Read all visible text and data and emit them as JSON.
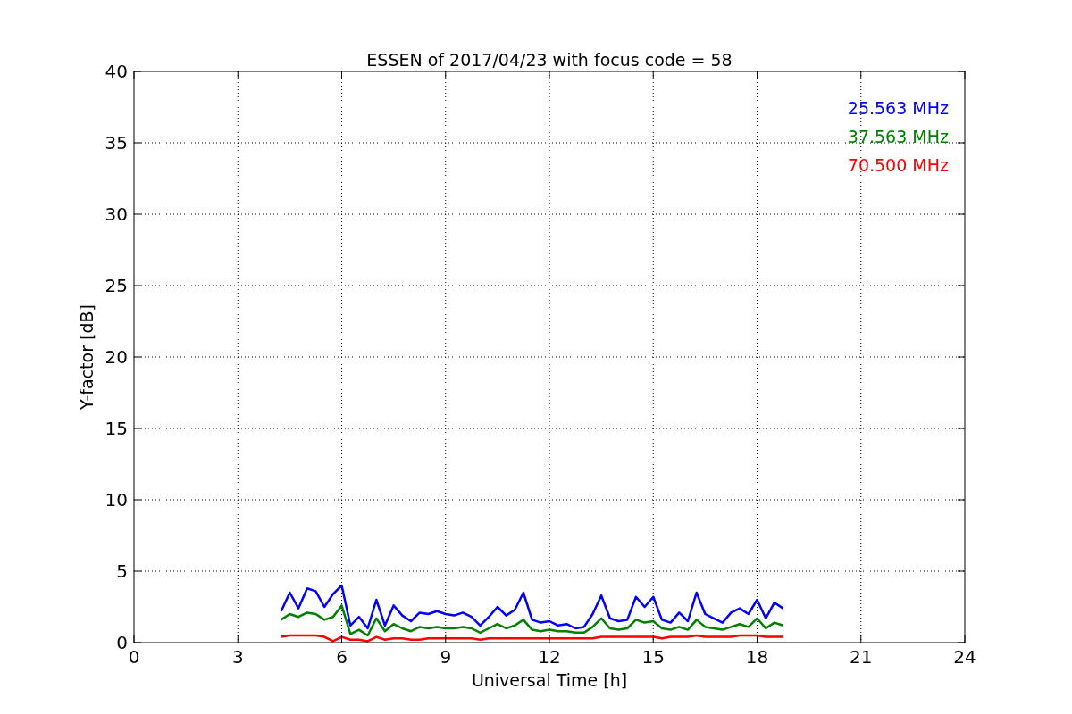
{
  "chart_data": {
    "type": "line",
    "title": "ESSEN of 2017/04/23 with focus code = 58",
    "xlabel": "Universal Time [h]",
    "ylabel": "Y-factor [dB]",
    "x": [
      4.25,
      4.5,
      4.75,
      5,
      5.25,
      5.5,
      5.75,
      6,
      6.25,
      6.5,
      6.75,
      7,
      7.25,
      7.5,
      7.75,
      8,
      8.25,
      8.5,
      8.75,
      9,
      9.25,
      9.5,
      9.75,
      10,
      10.25,
      10.5,
      10.75,
      11,
      11.25,
      11.5,
      11.75,
      12,
      12.25,
      12.5,
      12.75,
      13,
      13.25,
      13.5,
      13.75,
      14,
      14.25,
      14.5,
      14.75,
      15,
      15.25,
      15.5,
      15.75,
      16,
      16.25,
      16.5,
      16.75,
      17,
      17.25,
      17.5,
      17.75,
      18,
      18.25,
      18.5,
      18.75
    ],
    "series": [
      {
        "name": "25.563 MHz",
        "color": "#0000ff",
        "values": [
          2.2,
          3.5,
          2.4,
          3.8,
          3.6,
          2.5,
          3.4,
          4.0,
          1.2,
          1.8,
          1.0,
          3.0,
          1.2,
          2.6,
          1.9,
          1.5,
          2.1,
          2.0,
          2.2,
          2.0,
          1.9,
          2.1,
          1.8,
          1.2,
          1.8,
          2.5,
          1.9,
          2.3,
          3.5,
          1.6,
          1.4,
          1.5,
          1.2,
          1.3,
          1.0,
          1.1,
          2.0,
          3.3,
          1.7,
          1.5,
          1.6,
          3.2,
          2.5,
          3.2,
          1.6,
          1.4,
          2.1,
          1.5,
          3.5,
          2.0,
          1.7,
          1.4,
          2.1,
          2.4,
          2.0,
          3.0,
          1.7,
          2.8,
          2.4
        ]
      },
      {
        "name": "37.563 MHz",
        "color": "#008000",
        "values": [
          1.6,
          2.0,
          1.8,
          2.1,
          2.0,
          1.6,
          1.8,
          2.6,
          0.6,
          0.9,
          0.5,
          1.7,
          0.8,
          1.3,
          1.0,
          0.8,
          1.1,
          1.0,
          1.1,
          1.0,
          1.0,
          1.1,
          1.0,
          0.7,
          1.0,
          1.3,
          1.0,
          1.2,
          1.6,
          0.9,
          0.8,
          0.9,
          0.8,
          0.8,
          0.7,
          0.7,
          1.1,
          1.7,
          1.0,
          0.9,
          1.0,
          1.6,
          1.4,
          1.5,
          1.0,
          0.9,
          1.1,
          0.9,
          1.6,
          1.1,
          1.0,
          0.9,
          1.1,
          1.3,
          1.1,
          1.7,
          1.0,
          1.4,
          1.2
        ]
      },
      {
        "name": "70.500 MHz",
        "color": "#ff0000",
        "values": [
          0.4,
          0.5,
          0.5,
          0.5,
          0.5,
          0.4,
          0.1,
          0.4,
          0.2,
          0.2,
          0.1,
          0.4,
          0.2,
          0.3,
          0.3,
          0.2,
          0.2,
          0.3,
          0.3,
          0.3,
          0.3,
          0.3,
          0.3,
          0.2,
          0.3,
          0.3,
          0.3,
          0.3,
          0.3,
          0.3,
          0.3,
          0.3,
          0.3,
          0.3,
          0.3,
          0.3,
          0.3,
          0.4,
          0.4,
          0.4,
          0.4,
          0.4,
          0.4,
          0.4,
          0.3,
          0.4,
          0.4,
          0.4,
          0.5,
          0.4,
          0.4,
          0.4,
          0.4,
          0.5,
          0.5,
          0.5,
          0.4,
          0.4,
          0.4
        ]
      }
    ],
    "grid": true,
    "xlim": [
      0,
      24
    ],
    "ylim": [
      0,
      40
    ],
    "xticks": [
      0,
      3,
      6,
      9,
      12,
      15,
      18,
      21,
      24
    ],
    "yticks": [
      0,
      5,
      10,
      15,
      20,
      25,
      30,
      35,
      40
    ]
  }
}
